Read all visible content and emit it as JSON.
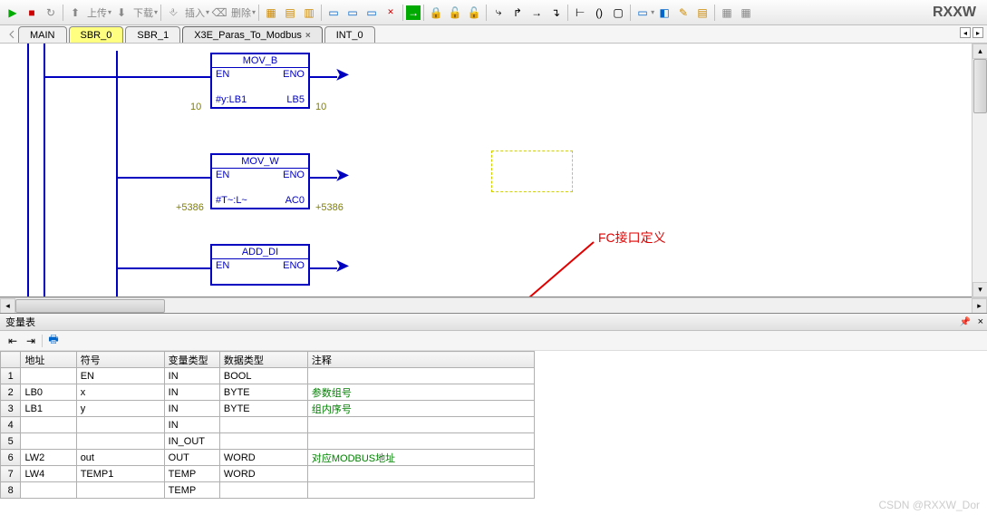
{
  "app_title": "RXXW",
  "toolbar": {
    "upload": "上传",
    "download": "下载",
    "insert": "插入",
    "delete": "删除"
  },
  "tabs": [
    {
      "label": "MAIN",
      "style": "plain"
    },
    {
      "label": "SBR_0",
      "style": "yellow"
    },
    {
      "label": "SBR_1",
      "style": "plain"
    },
    {
      "label": "X3E_Paras_To_Modbus",
      "style": "active"
    },
    {
      "label": "INT_0",
      "style": "plain"
    }
  ],
  "blocks": {
    "mov_b": {
      "title": "MOV_B",
      "en": "EN",
      "eno": "ENO",
      "in": "#y:LB1",
      "out": "LB5",
      "lval": "10",
      "rval": "10"
    },
    "mov_w": {
      "title": "MOV_W",
      "en": "EN",
      "eno": "ENO",
      "in": "#T~:L~",
      "out": "AC0",
      "lval": "+5386",
      "rval": "+5386"
    },
    "add_di": {
      "title": "ADD_DI",
      "en": "EN",
      "eno": "ENO"
    }
  },
  "annotation": "FC接口定义",
  "panel_title": "变量表",
  "table": {
    "headers": {
      "addr": "地址",
      "sym": "符号",
      "vtype": "变量类型",
      "dtype": "数据类型",
      "ann": "注释"
    },
    "rows": [
      {
        "n": "1",
        "addr": "",
        "sym": "EN",
        "vt": "IN",
        "dt": "BOOL",
        "ann": ""
      },
      {
        "n": "2",
        "addr": "LB0",
        "sym": "x",
        "vt": "IN",
        "dt": "BYTE",
        "ann": "参数组号"
      },
      {
        "n": "3",
        "addr": "LB1",
        "sym": "y",
        "vt": "IN",
        "dt": "BYTE",
        "ann": "组内序号"
      },
      {
        "n": "4",
        "addr": "",
        "sym": "",
        "vt": "IN",
        "dt": "",
        "ann": ""
      },
      {
        "n": "5",
        "addr": "",
        "sym": "",
        "vt": "IN_OUT",
        "dt": "",
        "ann": ""
      },
      {
        "n": "6",
        "addr": "LW2",
        "sym": "out",
        "vt": "OUT",
        "dt": "WORD",
        "ann": "对应MODBUS地址"
      },
      {
        "n": "7",
        "addr": "LW4",
        "sym": "TEMP1",
        "vt": "TEMP",
        "dt": "WORD",
        "ann": ""
      },
      {
        "n": "8",
        "addr": "",
        "sym": "",
        "vt": "TEMP",
        "dt": "",
        "ann": ""
      }
    ]
  },
  "watermark": "CSDN @RXXW_Dor"
}
